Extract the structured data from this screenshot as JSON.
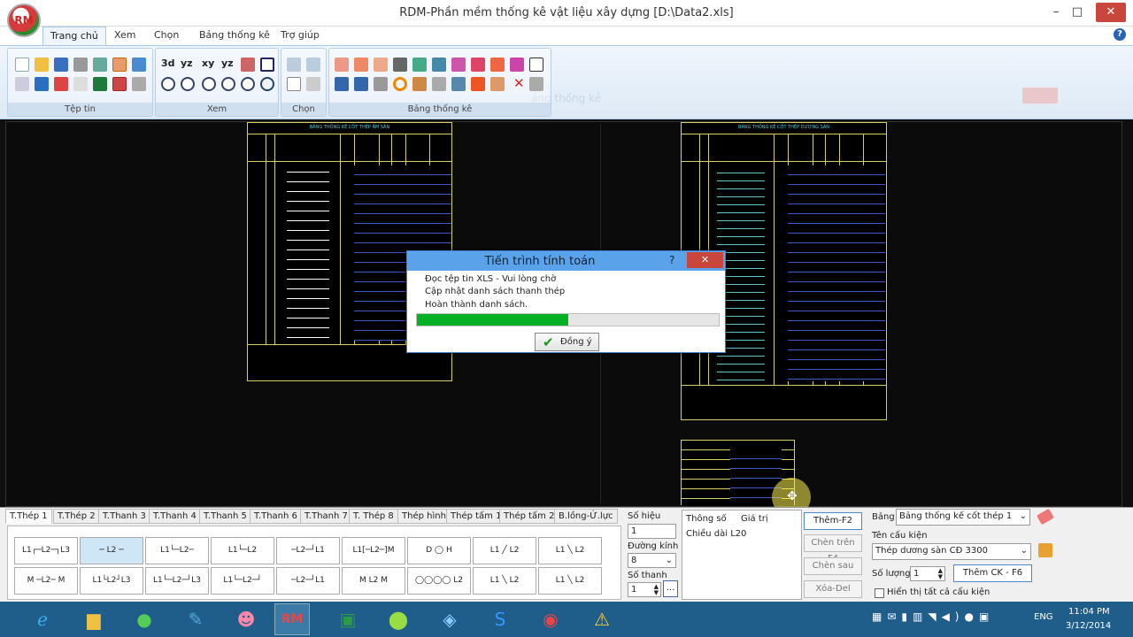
{
  "window": {
    "title": "RDM-Phần mềm thống kê vật liệu xây dựng [D:\\Data2.xls]",
    "logo_text": "RM",
    "controls": {
      "minimize": "–",
      "maximize": "□",
      "close": "✕"
    }
  },
  "menu_tabs": [
    "Trang chủ",
    "Xem",
    "Chọn",
    "Bảng thống kê",
    "Trợ giúp"
  ],
  "ribbon": {
    "groups": [
      "Tệp tin",
      "Xem",
      "Chọn",
      "Bảng thống kê"
    ],
    "view_labels": [
      "3d",
      "yz",
      "xy",
      "yz"
    ],
    "ghost_text": "ảng thống kê"
  },
  "drawings": {
    "left_title": "BẢNG THỐNG KÊ CỐT THÉP ÂM SÀN",
    "right_title": "BẢNG THỐNG KÊ CỐT THÉP DƯƠNG SÀN"
  },
  "dialog": {
    "title": "Tiến trình tính toán",
    "help": "?",
    "close": "✕",
    "lines": [
      "Đọc tệp tin XLS - Vui lòng chờ",
      "Cập nhật danh sách thanh thép",
      "Hoàn thành danh sách."
    ],
    "progress": 0.5,
    "ok": "Đồng ý"
  },
  "bottom_tabs": [
    "T.Thép 1",
    "T.Thép 2",
    "T.Thanh 3",
    "T.Thanh 4",
    "T.Thanh 5",
    "T.Thanh 6",
    "T.Thanh 7",
    "T. Thép 8",
    "Thép hình",
    "Thép tấm 1",
    "Thép tấm 2",
    "B.lồng-Ứ.lực"
  ],
  "form": {
    "so_hieu_label": "Số hiệu",
    "so_hieu_value": "1",
    "duong_kinh_label": "Đường kính",
    "duong_kinh_value": "8",
    "so_thanh_label": "Số thanh",
    "so_thanh_value": "1",
    "more": "...",
    "param_headers": [
      "Thông số",
      "Giá trị"
    ],
    "param_row": [
      "Chiều dài L2",
      "0"
    ],
    "them": "Thêm-F2",
    "chen_tren": "Chèn trên F4",
    "chen_sau": "Chèn sau",
    "xoa": "Xóa-Del",
    "bang_label": "Bảng",
    "bang_value": "Bảng thống kế cốt thép 1",
    "ten_ck_label": "Tên cấu kiện",
    "ten_ck_value": "Thép dương sàn CĐ 3300",
    "so_luong_label": "Số lượng",
    "so_luong_value": "1",
    "them_ck": "Thêm CK - F6",
    "hien_thi": "Hiển thị tất cả cấu kiện"
  },
  "taskbar": {
    "lang": "ENG",
    "time": "11:04 PM",
    "date": "3/12/2014"
  },
  "colors": {
    "accent": "#5aa3ea",
    "progress": "#06b025",
    "close": "#c9463d",
    "drawing": "#d8d060",
    "taskbar": "#1f5d8a"
  }
}
